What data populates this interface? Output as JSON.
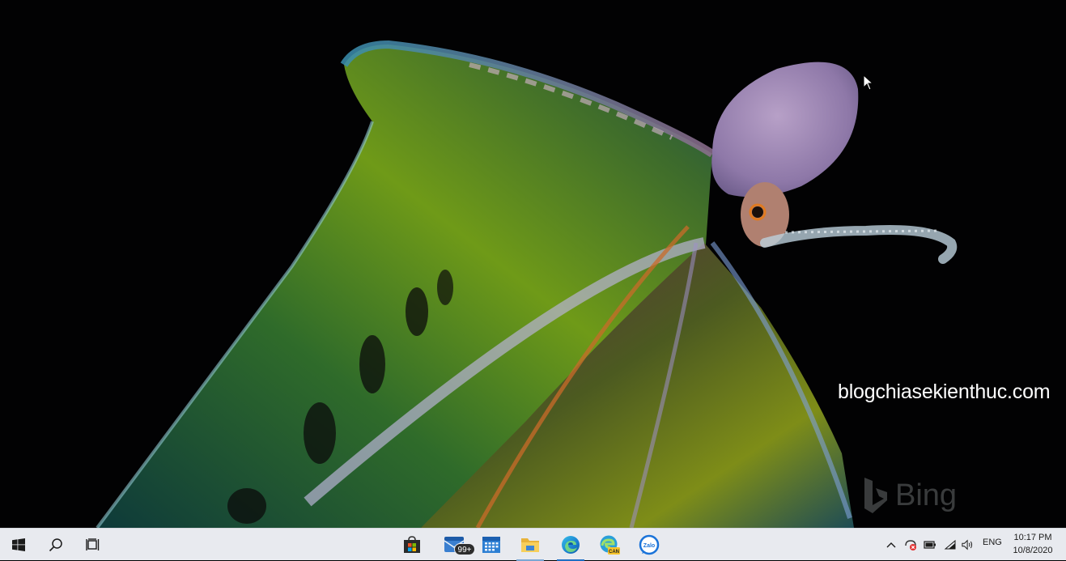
{
  "desktop": {
    "watermark_text": "blogchiasekienthuc.com",
    "bing_logo_text": "Bing"
  },
  "taskbar": {
    "start_icon": "windows-logo-icon",
    "search_icon": "search-icon",
    "task_view_icon": "task-view-icon",
    "pinned_apps": [
      {
        "name": "Microsoft Store",
        "icon": "store-icon"
      },
      {
        "name": "Mail",
        "icon": "mail-icon",
        "badge": "99+"
      },
      {
        "name": "Calendar",
        "icon": "calendar-icon"
      },
      {
        "name": "File Explorer",
        "icon": "folder-icon"
      },
      {
        "name": "Microsoft Edge",
        "icon": "edge-icon"
      },
      {
        "name": "Microsoft Edge Canary",
        "icon": "edge-canary-icon",
        "label": "CAN"
      },
      {
        "name": "Zalo",
        "icon": "zalo-icon",
        "label": "Zalo"
      }
    ],
    "tray": {
      "language": "ENG",
      "time": "10:17 PM",
      "date": "10/8/2020"
    }
  },
  "colors": {
    "taskbar_bg": "#e8eaef",
    "accent": "#1f6fc4",
    "desktop_bg": "#020203"
  }
}
